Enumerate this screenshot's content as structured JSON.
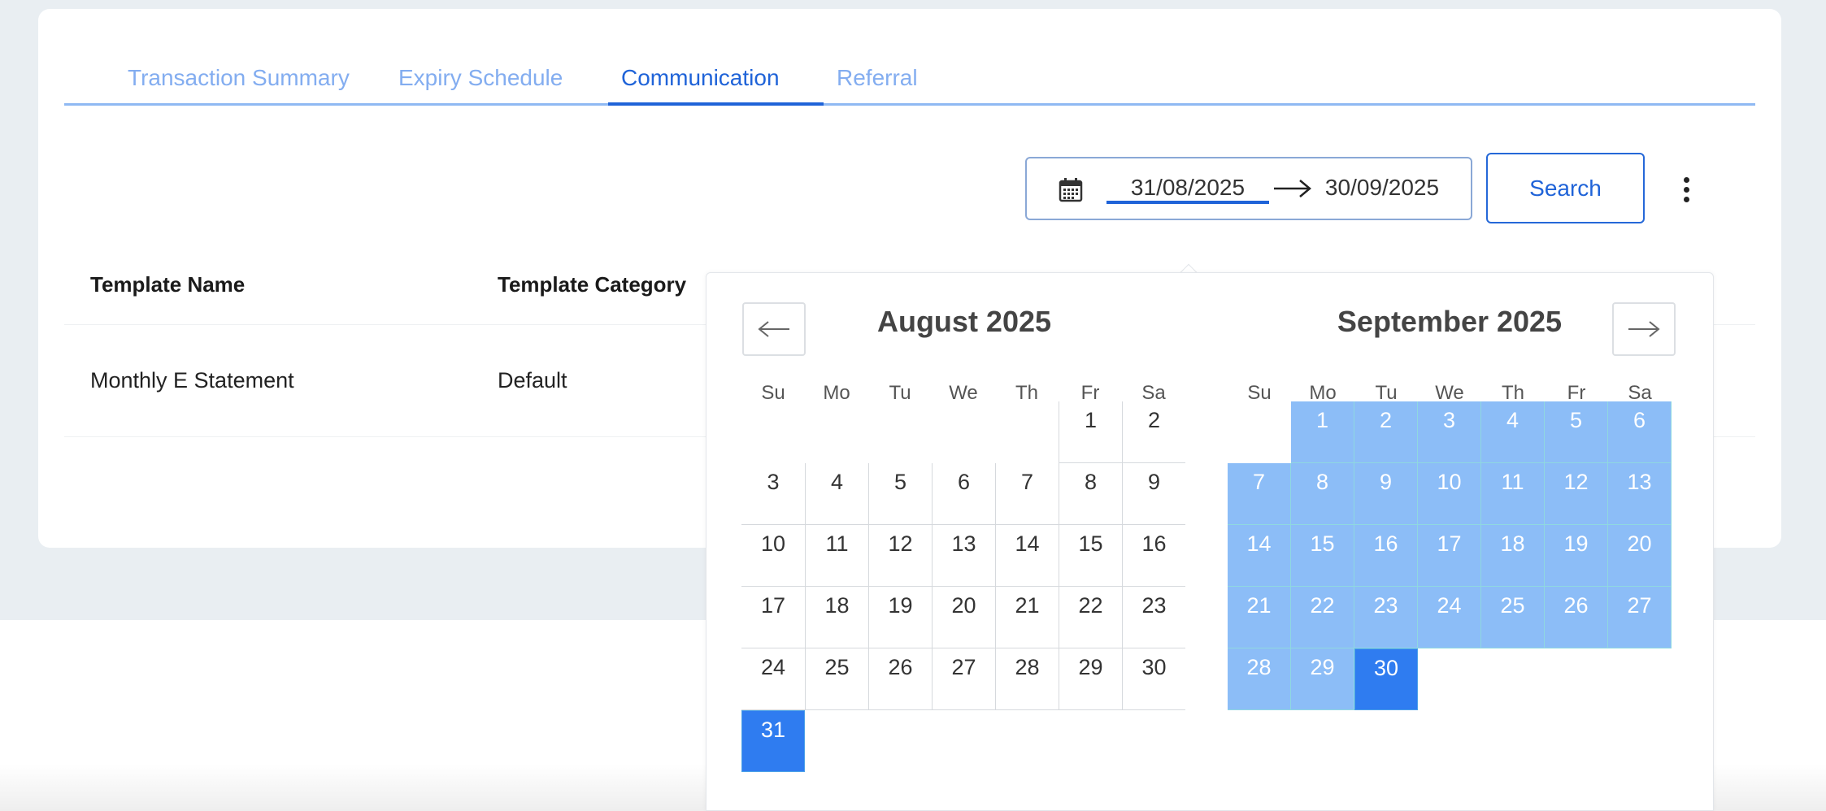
{
  "tabs": [
    {
      "label": "Transaction Summary"
    },
    {
      "label": "Expiry Schedule"
    },
    {
      "label": "Communication"
    },
    {
      "label": "Referral"
    }
  ],
  "active_tab": "Communication",
  "date_range": {
    "start": "31/08/2025",
    "end": "30/09/2025",
    "icon": "calendar-icon"
  },
  "search_label": "Search",
  "table": {
    "headers": [
      "Template Name",
      "Template Category"
    ],
    "rows": [
      [
        "Monthly E Statement",
        "Default"
      ]
    ]
  },
  "calendar": {
    "weekdays": [
      "Su",
      "Mo",
      "Tu",
      "We",
      "Th",
      "Fr",
      "Sa"
    ],
    "months": [
      {
        "title": "August 2025",
        "first_weekday": 5,
        "days": 31,
        "selected": [
          31
        ],
        "in_range": []
      },
      {
        "title": "September 2025",
        "first_weekday": 1,
        "days": 30,
        "selected": [
          30
        ],
        "in_range_through": 29
      }
    ]
  },
  "colors": {
    "accent": "#1f63d8",
    "tab_inactive": "#83adf0",
    "range_fill": "#8cbdf7",
    "selected_fill": "#2f7cf0"
  }
}
